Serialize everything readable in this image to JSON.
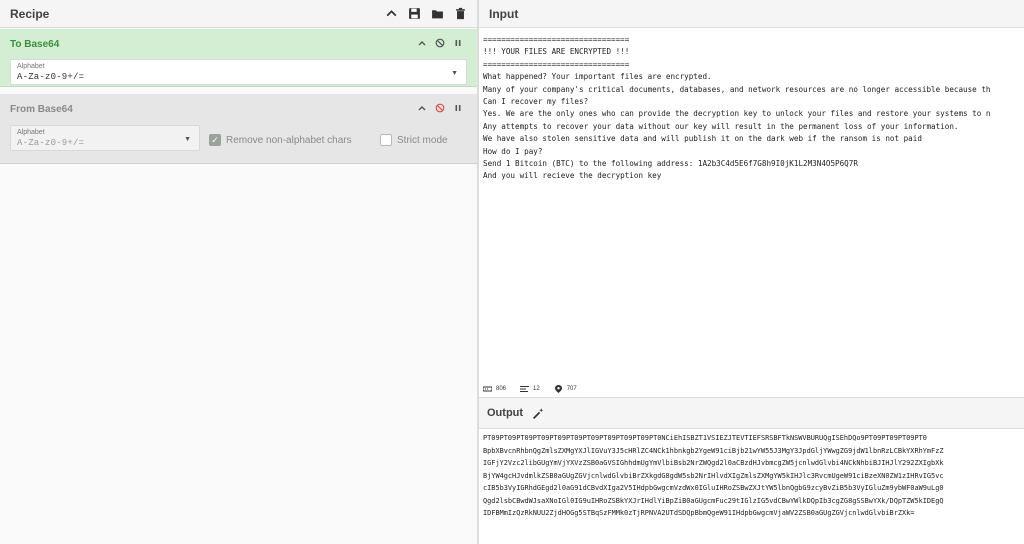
{
  "recipe": {
    "title": "Recipe",
    "operations": [
      {
        "name": "To Base64",
        "alphabet_label": "Alphabet",
        "alphabet_value": "A-Za-z0-9+/="
      },
      {
        "name": "From Base64",
        "alphabet_label": "Alphabet",
        "alphabet_value": "A-Za-z0-9+/=",
        "remove_non_alphabet_label": "Remove non-alphabet chars",
        "remove_non_alphabet_checked": true,
        "strict_mode_label": "Strict mode",
        "strict_mode_checked": false
      }
    ]
  },
  "input": {
    "title": "Input",
    "lines": [
      "================================",
      "!!! YOUR FILES ARE ENCRYPTED !!!",
      "================================",
      "What happened? Your important files are encrypted.",
      "Many of your company's critical documents, databases, and network resources are no longer accessible because th",
      "Can I recover my files?",
      "Yes. We are the only ones who can provide the decryption key to unlock your files and restore your systems to n",
      "Any attempts to recover your data without our key will result in the permanent loss of your information.",
      "We have also stolen sensitive data and will publish it on the dark web if the ransom is not paid",
      "How do I pay?",
      "Send 1 Bitcoin (BTC) to the following address: 1A2b3C4d5E6f7G8h9I0jK1L2M3N4O5P6Q7R",
      "And you will recieve the decryption key"
    ]
  },
  "status": {
    "length": "806",
    "lines": "12",
    "position": "707"
  },
  "output": {
    "title": "Output",
    "lines": [
      "PT09PT09PT09PT09PT09PT09PT09PT09PT09PT09PT0NCiEhISBZT1VSIEZJTEVTIEFSRSBFTkNSWVBURUQgISEhDQo9PT09PT09PT09PT0",
      "BpbXBvcnRhbnQgZmlsZXMgYXJlIGVuY3J5cHRlZC4NCk1hbnkgb2YgeW91ciBjb21wYW55J3MgY3JpdGljYWwgZG9jdW1lbnRzLCBkYXRhYmFzZ",
      "IGFjY2Vzc2libGUgYmVjYXVzZSB0aGVSIGhhdmUgYmVlbiBsb2NrZWQgd2l0aCBzdHJvbmcgZW5jcnlwdGlvbi4NCkNhbiBJIHJlY292ZXIgbXk",
      "BjYW4gcHJvdmlkZSB0aGUgZGVjcnlwdGlvbiBrZXkgdG8gdW5sb2NrIHlvdXIgZmlsZXMgYW5kIHJlc3RvcmUgeW91ciBzeXN0ZW1zIHRvIG5vc",
      "cIB5b3VyIGRhdGEgd2l0aG91dCBvdXIga2V5IHdpbGwgcmVzdWx0IGluIHRoZSBwZXJtYW5lbnQgbG9zcyBvZiB5b3VyIGluZm9ybWF0aW9uLg0",
      "Qgd2lsbCBwdWJsaXNoIGl0IG9uIHRoZSBkYXJrIHdlYiBpZiB0aGUgcmFuc29tIGlzIG5vdCBwYWlkDQpIb3cgZG8gSSBwYXk/DQpTZW5kIDEgQ",
      "IDFBMmIzQzRkNUU2ZjdHOGg5STBqSzFMMk0zTjRPNVA2UTdSDQpBbmQgeW91IHdpbGwgcmVjaWV2ZSB0aGUgZGVjcnlwdGlvbiBrZXk="
    ]
  }
}
